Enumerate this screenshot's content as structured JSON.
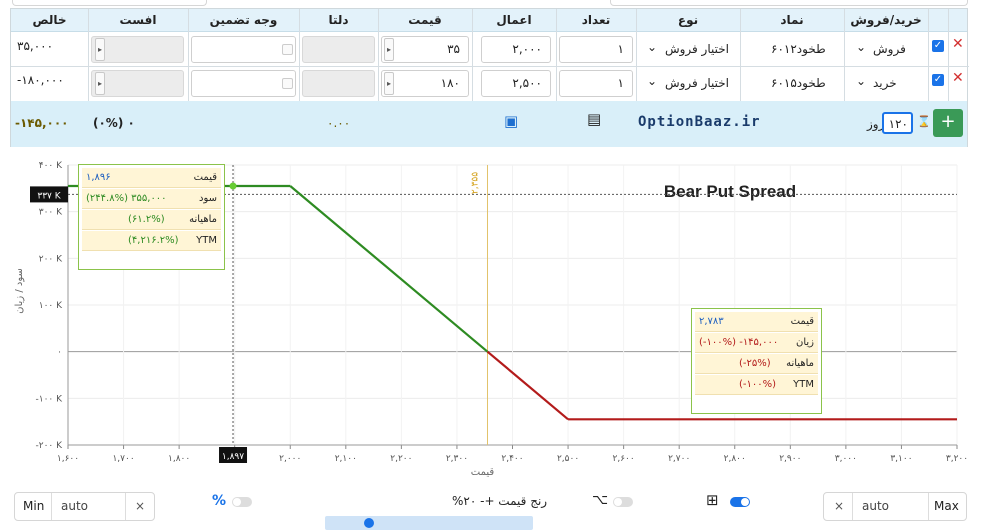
{
  "table": {
    "headers": {
      "side": "خرید/فروش",
      "symbol": "نماد",
      "type": "نوع",
      "qty": "تعداد",
      "strike": "اعمال",
      "price": "قیمت",
      "delta": "دلتا",
      "margin": "وجه تضمین",
      "theta": "افست",
      "net": "خالص"
    },
    "rows": [
      {
        "side": "فروش",
        "symbol": "طخود۶۰۱۲",
        "type": "اختیار فروش",
        "qty": "۱",
        "strike": "۲,۰۰۰",
        "price": "۳۵",
        "net": "۳۵,۰۰۰"
      },
      {
        "side": "خرید",
        "symbol": "طخود۶۰۱۵",
        "type": "اختیار فروش",
        "qty": "۱",
        "strike": "۲,۵۰۰",
        "price": "۱۸۰",
        "net": "-۱۸۰,۰۰۰"
      }
    ],
    "summary": {
      "days_value": "۱۲۰",
      "days_label": "روز",
      "brand": "OptionBaaz.ir",
      "delta_sum": "۰.۰۰",
      "percent": "(۰%) ۰",
      "net_total": "-۱۴۵,۰۰۰"
    }
  },
  "chart_data": {
    "type": "line",
    "title": "Bear Put Spread",
    "xlabel": "قیمت",
    "ylabel": "سود / زیان",
    "xlim": [
      1600,
      3200
    ],
    "ylim": [
      -200000,
      400000
    ],
    "x_ticks": [
      "۱,۶۰۰",
      "۱,۷۰۰",
      "۱,۸۰۰",
      "۱,۹۰۰",
      "۲,۰۰۰",
      "۲,۱۰۰",
      "۲,۲۰۰",
      "۲,۳۰۰",
      "۲,۴۰۰",
      "۲,۵۰۰",
      "۲,۶۰۰",
      "۲,۷۰۰",
      "۲,۸۰۰",
      "۲,۹۰۰",
      "۳,۰۰۰",
      "۳,۱۰۰",
      "۳,۲۰۰"
    ],
    "y_ticks": [
      {
        "v": 400000,
        "label": "۴۰۰ K"
      },
      {
        "v": 300000,
        "label": "۳۰۰ K"
      },
      {
        "v": 200000,
        "label": "۲۰۰ K"
      },
      {
        "v": 100000,
        "label": "۱۰۰ K"
      },
      {
        "v": 0,
        "label": "۰"
      },
      {
        "v": -100000,
        "label": "-۱۰۰ K"
      },
      {
        "v": -200000,
        "label": "-۲۰۰ K"
      }
    ],
    "series": [
      {
        "x": [
          1600,
          2000,
          2355,
          2500,
          3200
        ],
        "y": [
          355000,
          355000,
          0,
          -145000,
          -145000
        ]
      }
    ],
    "break_even": {
      "x": 2355,
      "label": "۲,۳۵۵"
    },
    "cursor": {
      "x": 1897,
      "label": "۱,۸۹۷",
      "y_value": 337000,
      "y_label": "۳۳۷ K"
    },
    "tooltips": [
      {
        "price_label": "قیمت",
        "price": "۱,۸۹۶",
        "pl_label": "سود",
        "pl": "(۲۴۴.۸%)  ۳۵۵,۰۰۰",
        "monthly_label": "ماهیانه",
        "monthly": "(۶۱.۲%)",
        "ytm_label": "YTM",
        "ytm": "(۴,۲۱۶.۲%)"
      },
      {
        "price_label": "قیمت",
        "price": "۲,۷۸۳",
        "pl_label": "زیان",
        "pl": "(-۱۰۰%)  -۱۴۵,۰۰۰",
        "monthly_label": "ماهیانه",
        "monthly": "(-۲۵%)",
        "ytm_label": "YTM",
        "ytm": "(-۱۰۰%)"
      }
    ],
    "colors": {
      "profit": "#2e8b22",
      "loss": "#b31b1b",
      "break_even": "#e2c36b"
    }
  },
  "controls": {
    "min_label": "Min",
    "min_value": "auto",
    "max_label": "Max",
    "max_value": "auto",
    "percent_icon": "%",
    "range_label": "رنج قیمت +- ۲۰%",
    "clear": "×"
  }
}
